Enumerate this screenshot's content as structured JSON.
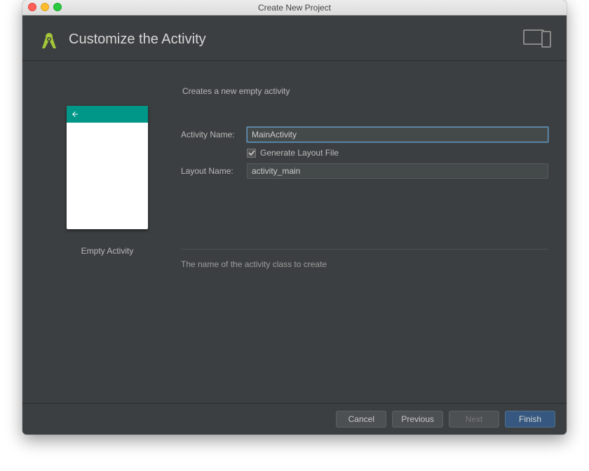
{
  "window": {
    "title": "Create New Project"
  },
  "header": {
    "title": "Customize the Activity"
  },
  "preview": {
    "label": "Empty Activity"
  },
  "form": {
    "description": "Creates a new empty activity",
    "activity_name": {
      "label": "Activity Name:",
      "value": "MainActivity"
    },
    "generate_layout": {
      "label": "Generate Layout File",
      "checked": true
    },
    "layout_name": {
      "label": "Layout Name:",
      "value": "activity_main"
    },
    "hint": "The name of the activity class to create"
  },
  "buttons": {
    "cancel": "Cancel",
    "previous": "Previous",
    "next": "Next",
    "finish": "Finish"
  }
}
